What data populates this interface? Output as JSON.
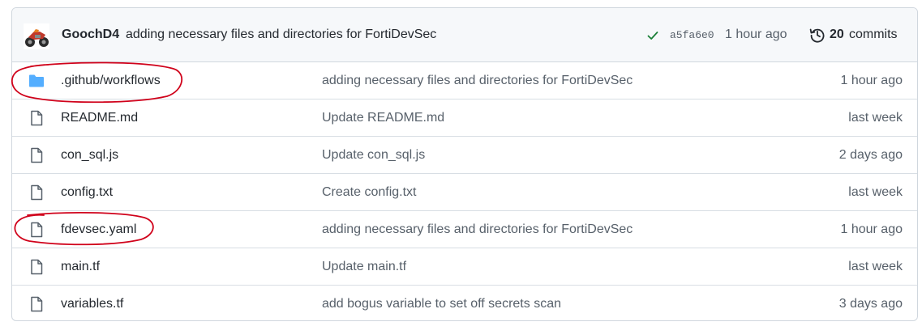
{
  "latest_commit": {
    "author": "GoochD4",
    "message": "adding necessary files and directories for FortiDevSec",
    "sha": "a5fa6e0",
    "time": "1 hour ago",
    "commit_count": "20",
    "commits_label": "commits",
    "status": "success"
  },
  "files": [
    {
      "name": ".github/workflows",
      "type": "folder",
      "message": "adding necessary files and directories for FortiDevSec",
      "age": "1 hour ago"
    },
    {
      "name": "README.md",
      "type": "file",
      "message": "Update README.md",
      "age": "last week"
    },
    {
      "name": "con_sql.js",
      "type": "file",
      "message": "Update con_sql.js",
      "age": "2 days ago"
    },
    {
      "name": "config.txt",
      "type": "file",
      "message": "Create config.txt",
      "age": "last week"
    },
    {
      "name": "fdevsec.yaml",
      "type": "file",
      "message": "adding necessary files and directories for FortiDevSec",
      "age": "1 hour ago"
    },
    {
      "name": "main.tf",
      "type": "file",
      "message": "Update main.tf",
      "age": "last week"
    },
    {
      "name": "variables.tf",
      "type": "file",
      "message": "add bogus variable to set off secrets scan",
      "age": "3 days ago"
    }
  ],
  "colors": {
    "folder": "#54aeff",
    "check": "#1a7f37",
    "annotation": "#d0021b"
  },
  "icons": {
    "folder": "folder-icon",
    "file": "file-icon",
    "check": "check-icon",
    "history": "history-icon",
    "avatar": "avatar-image"
  }
}
